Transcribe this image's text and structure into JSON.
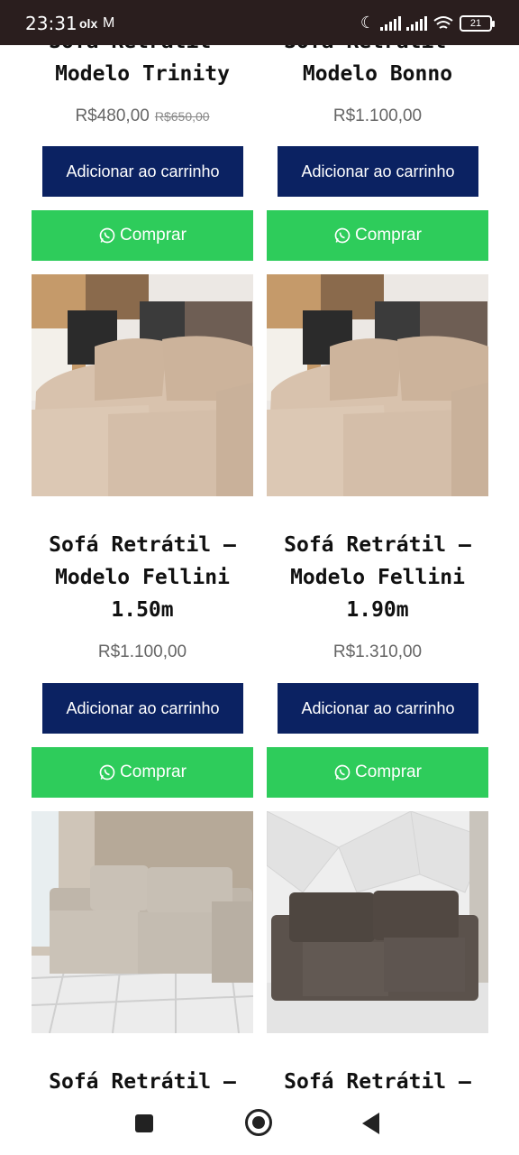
{
  "status_bar": {
    "time": "23:31",
    "app_icons": [
      "olx",
      "gmail"
    ],
    "battery": "21"
  },
  "products": [
    {
      "title_line1": "Sofá Retrátil –",
      "title_line2": "Modelo Trinity",
      "title_line3": "",
      "price": "R$480,00",
      "old_price": "R$650,00",
      "cart_label": "Adicionar ao carrinho",
      "buy_label": "Comprar"
    },
    {
      "title_line1": "Sofá Retrátil –",
      "title_line2": "Modelo Bonno",
      "title_line3": "",
      "price": "R$1.100,00",
      "old_price": "",
      "cart_label": "Adicionar ao carrinho",
      "buy_label": "Comprar"
    },
    {
      "title_line1": "Sofá Retrátil –",
      "title_line2": "Modelo Fellini",
      "title_line3": "1.50m",
      "price": "R$1.100,00",
      "old_price": "",
      "cart_label": "Adicionar ao carrinho",
      "buy_label": "Comprar",
      "image_icon": "beige-sofa-photo"
    },
    {
      "title_line1": "Sofá Retrátil –",
      "title_line2": "Modelo Fellini",
      "title_line3": "1.90m",
      "price": "R$1.310,00",
      "old_price": "",
      "cart_label": "Adicionar ao carrinho",
      "buy_label": "Comprar",
      "image_icon": "beige-sofa-photo"
    },
    {
      "title_line1": "Sofá Retrátil –",
      "image_icon": "light-gray-sofa-photo"
    },
    {
      "title_line1": "Sofá Retrátil –",
      "image_icon": "dark-gray-sofa-photo"
    }
  ],
  "colors": {
    "cart_button": "#0b2262",
    "buy_button": "#2ecc5b",
    "status_bar": "#2a1e1e"
  }
}
